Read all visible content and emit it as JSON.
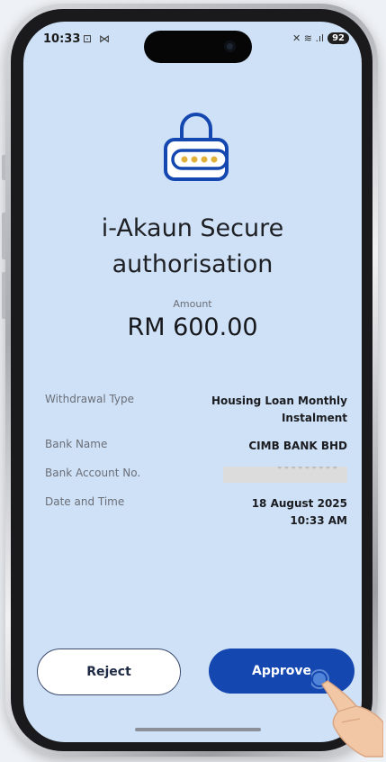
{
  "status_bar": {
    "time": "10:33",
    "left_icons": "⊡ ⋈",
    "right_icons": "✕ ≋ .ıl",
    "battery": "92"
  },
  "page": {
    "title_line1": "i-Akaun Secure",
    "title_line2": "authorisation",
    "amount_label": "Amount",
    "amount_value": "RM 600.00"
  },
  "details": {
    "withdrawal_type_label": "Withdrawal Type",
    "withdrawal_type_value_line1": "Housing Loan Monthly",
    "withdrawal_type_value_line2": "Instalment",
    "bank_name_label": "Bank Name",
    "bank_name_value": "CIMB BANK BHD",
    "bank_account_label": "Bank Account No.",
    "date_time_label": "Date and Time",
    "date_value": "18 August 2025",
    "time_value": "10:33 AM"
  },
  "actions": {
    "reject_label": "Reject",
    "approve_label": "Approve"
  },
  "colors": {
    "screen_bg": "#cfe1f7",
    "approve_bg": "#1447b0",
    "lock_outline": "#1447b0",
    "lock_dots": "#e2b23a"
  },
  "icons": {
    "lock": "padlock-password-icon",
    "tap": "tap-hand-icon"
  }
}
